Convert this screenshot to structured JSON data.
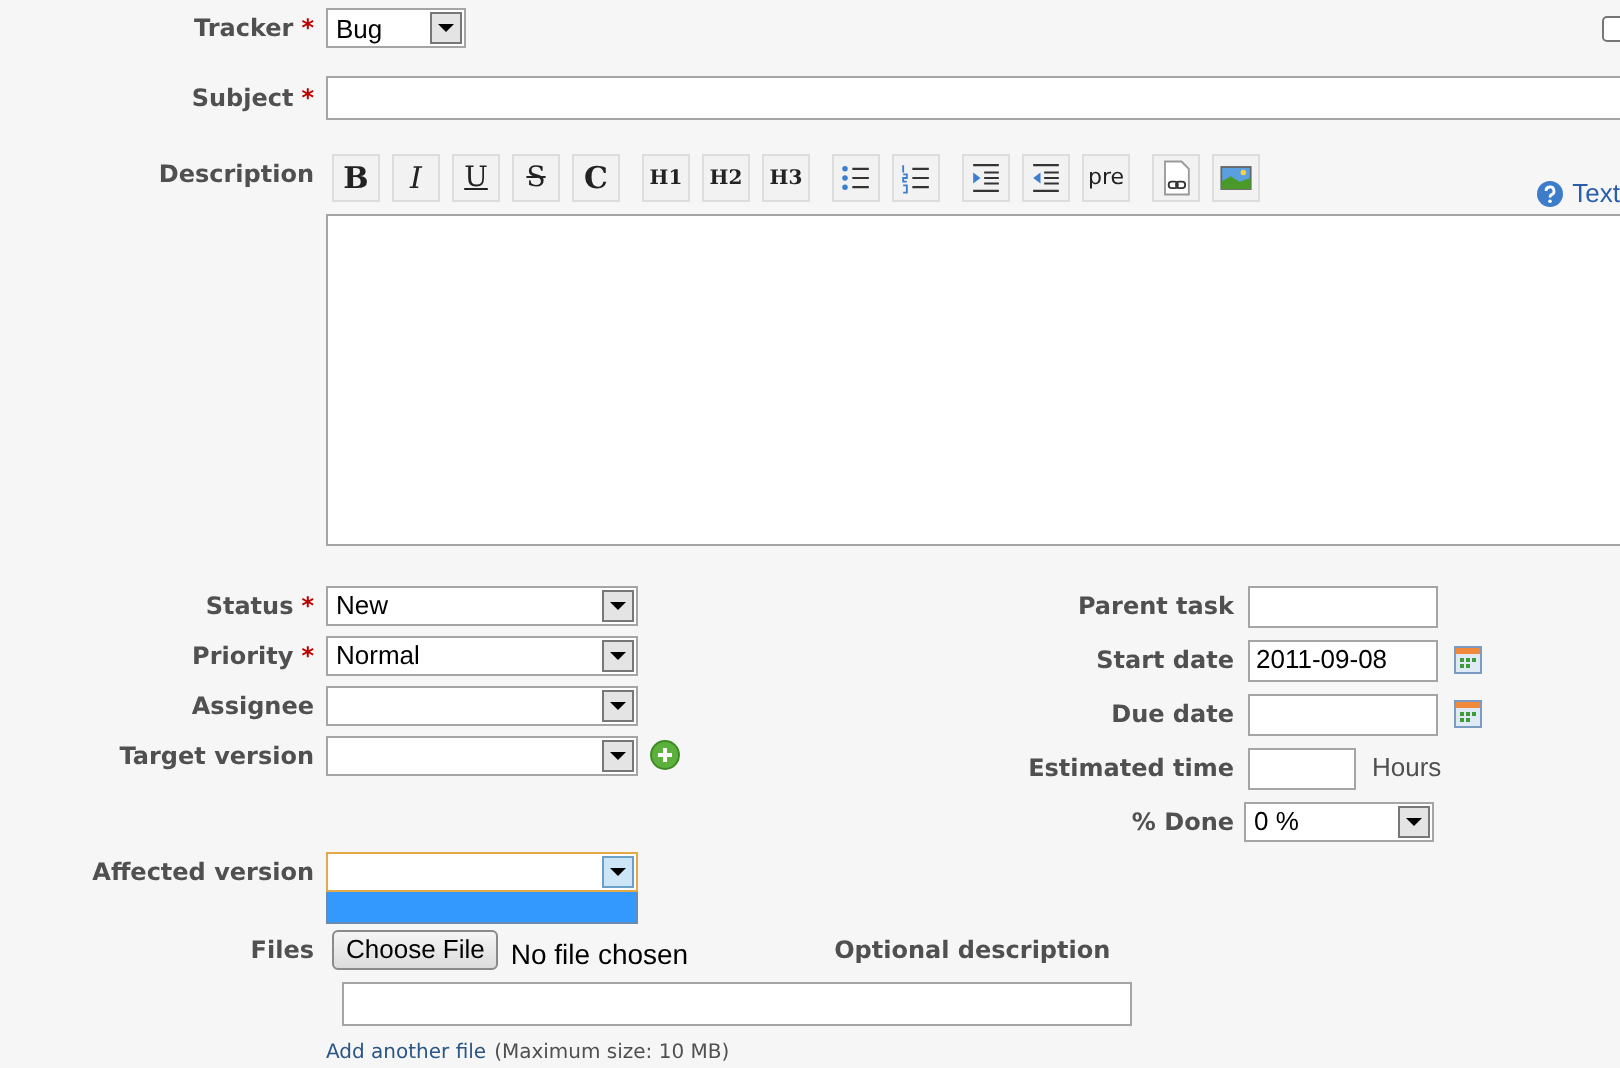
{
  "tracker": {
    "label": "Tracker",
    "mark": "*",
    "value": "Bug"
  },
  "top_right_checkbox": {
    "checked": false
  },
  "subject": {
    "label": "Subject",
    "mark": "*"
  },
  "description": {
    "label": "Description",
    "toolbar": [
      [
        {
          "kind": "bold",
          "label": "B"
        },
        {
          "kind": "italic",
          "label": "I"
        },
        {
          "kind": "underline",
          "label": "U"
        },
        {
          "kind": "strike",
          "label": "S"
        },
        {
          "kind": "code",
          "label": "C"
        }
      ],
      [
        {
          "kind": "heading",
          "label": "H1"
        },
        {
          "kind": "heading",
          "label": "H2"
        },
        {
          "kind": "heading",
          "label": "H3"
        }
      ],
      [
        {
          "kind": "bullet-list"
        },
        {
          "kind": "numbered-list"
        }
      ],
      [
        {
          "kind": "indent"
        },
        {
          "kind": "outdent"
        },
        {
          "kind": "pre",
          "label": "pre"
        }
      ],
      [
        {
          "kind": "link"
        },
        {
          "kind": "image"
        }
      ]
    ],
    "help_link": "Text"
  },
  "left_fields": [
    {
      "label": "Status",
      "mark": "*",
      "kind": "select",
      "value": "New"
    },
    {
      "label": "Priority",
      "mark": "*",
      "kind": "select",
      "value": "Normal"
    },
    {
      "label": "Assignee",
      "kind": "select"
    },
    {
      "label": "Target version",
      "kind": "select",
      "add_button": true
    }
  ],
  "right_fields": [
    {
      "label": "Parent task",
      "kind": "text"
    },
    {
      "label": "Start date",
      "kind": "date",
      "value": "2011-09-08"
    },
    {
      "label": "Due date",
      "kind": "date"
    },
    {
      "label": "Estimated time",
      "kind": "number",
      "unit": "Hours"
    },
    {
      "label": "% Done",
      "kind": "select",
      "value": "0 %"
    }
  ],
  "custom_fields": [
    {
      "label": "Affected version",
      "kind": "select",
      "expanded": true
    }
  ],
  "files": {
    "label": "Files",
    "button": "Choose File",
    "status": "No file chosen",
    "description_label": "Optional description",
    "add_link": "Add another file",
    "note": "(Maximum size: 10 MB)"
  }
}
